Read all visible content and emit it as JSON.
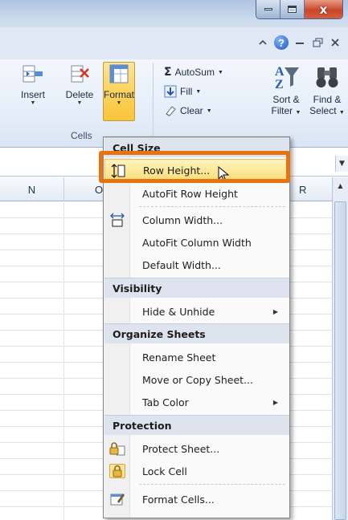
{
  "window": {
    "minimize_glyph": "",
    "maximize_glyph": "",
    "close_glyph": "x"
  },
  "ribbon_controls": {
    "help_glyph": "?"
  },
  "ribbon": {
    "insert_label": "Insert",
    "delete_label": "Delete",
    "format_label": "Format",
    "cells_group": "Cells",
    "autosum_label": "AutoSum",
    "fill_label": "Fill",
    "clear_label": "Clear",
    "sort_filter_line1": "Sort &",
    "sort_filter_line2": "Filter",
    "find_select_line1": "Find &",
    "find_select_line2": "Select",
    "sigma_glyph": "Σ"
  },
  "columns": {
    "n": "N",
    "o": "O",
    "r": "R"
  },
  "menu": {
    "sections": {
      "cell_size": "Cell Size",
      "visibility": "Visibility",
      "organize_sheets": "Organize Sheets",
      "protection": "Protection"
    },
    "items": {
      "row_height": "Row Height...",
      "autofit_row_height": "AutoFit Row Height",
      "column_width": "Column Width...",
      "autofit_column_width": "AutoFit Column Width",
      "default_width": "Default Width...",
      "hide_unhide": "Hide & Unhide",
      "rename_sheet": "Rename Sheet",
      "move_copy_sheet": "Move or Copy Sheet...",
      "tab_color": "Tab Color",
      "protect_sheet": "Protect Sheet...",
      "lock_cell": "Lock Cell",
      "format_cells": "Format Cells..."
    }
  },
  "colors": {
    "highlight": "#fde89a",
    "callout": "#e7730f",
    "section_bg": "#dde4ee"
  }
}
